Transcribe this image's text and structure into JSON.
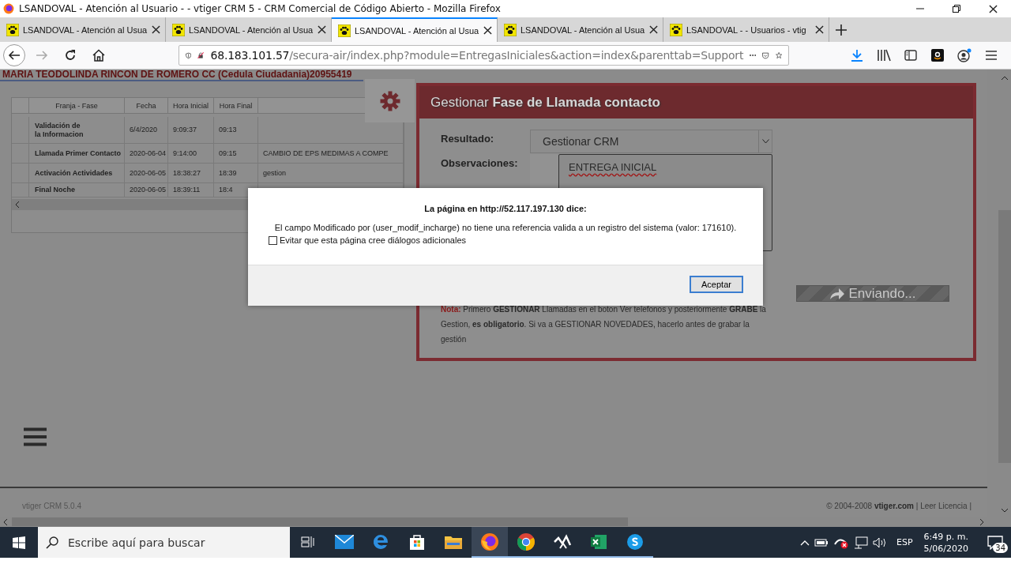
{
  "window": {
    "title": "LSANDOVAL - Atención al Usuario - - vtiger CRM 5 - CRM Comercial de Código Abierto - Mozilla Firefox"
  },
  "tabs": [
    {
      "label": "LSANDOVAL - Atención al Usua",
      "selected": false
    },
    {
      "label": "LSANDOVAL - Atención al Usua",
      "selected": false
    },
    {
      "label": "LSANDOVAL - Atención al Usua",
      "selected": true
    },
    {
      "label": "LSANDOVAL - Atención al Usua",
      "selected": false
    },
    {
      "label": "LSANDOVAL - - Usuarios - vtig",
      "selected": false
    }
  ],
  "address_bar": {
    "host": "68.183.101.57",
    "path": "/secura-air/index.php?module=EntregasIniciales&action=index&parenttab=Support"
  },
  "page": {
    "record_title": "MARIA TEODOLINDA RINCON DE ROMERO CC (Cedula Ciudadania)20955419",
    "table": {
      "columns": [
        "Franja - Fase",
        "Fecha",
        "Hora Inicial",
        "Hora Final"
      ],
      "rows": [
        [
          "Validación de\nla Informacion",
          "6/4/2020",
          "9:09:37",
          "09:13"
        ],
        [
          "Llamada Primer Contacto",
          "2020-06-04",
          "9:14:00",
          "09:15",
          "CAMBIO DE EPS MEDIMAS A COMPE"
        ],
        [
          "Activación Actividades",
          "2020-06-05",
          "18:38:27",
          "18:39",
          "gestion"
        ],
        [
          "Final Noche",
          "2020-06-05",
          "18:39:11",
          "18:4"
        ]
      ]
    },
    "panel": {
      "title": "Gestionar **Fase de Llamada contacto**",
      "fields": [
        {
          "label": "Resultado:",
          "kind": "select",
          "value": "Gestionar CRM"
        },
        {
          "label": "Observaciones:",
          "kind": "textarea",
          "value": "ENTREGA INICIAL"
        }
      ],
      "send_button": "Enviando...",
      "note_label": "Nota:",
      "note": "Primero **GESTIONAR** Llamadas en el boton Ver telefonos y posteriormente **GRABE** la Gestion, **es obligatorio**. Si va a GESTIONAR NOVEDADES, hacerlo antes de grabar la gestión"
    },
    "footer": {
      "version": "vtiger CRM 5.0.4",
      "copyright": "© 2004-2008 **vtiger.com** | Leer Licencia |"
    }
  },
  "dialog": {
    "title": "La página en http://52.117.197.130 dice:",
    "message": "El campo Modificado por (user_modif_incharge) no tiene una referencia valida a un registro del sistema (valor: 171610).",
    "checkbox": {
      "label": "Evitar que esta página cree diálogos adicionales",
      "checked": false
    },
    "button": "Aceptar"
  },
  "taskbar": {
    "search_placeholder": "Escribe aquí para buscar",
    "apps": [
      {
        "kind": "taskview",
        "running": false,
        "selected": false
      },
      {
        "kind": "mail",
        "running": false,
        "selected": false
      },
      {
        "kind": "edge",
        "running": false,
        "selected": false
      },
      {
        "kind": "store",
        "running": false,
        "selected": false
      },
      {
        "kind": "explorer",
        "running": false,
        "selected": false
      },
      {
        "kind": "firefox",
        "running": true,
        "selected": true
      },
      {
        "kind": "chrome",
        "running": true,
        "selected": false
      },
      {
        "kind": "tool",
        "running": true,
        "selected": false
      },
      {
        "kind": "excel",
        "running": true,
        "selected": false
      },
      {
        "kind": "skype",
        "running": true,
        "selected": false
      }
    ],
    "language": "ESP",
    "time": "6:49 p. m.",
    "date": "5/06/2020",
    "notifications": "34"
  }
}
